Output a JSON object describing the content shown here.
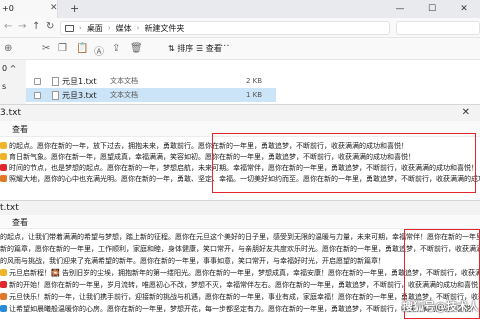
{
  "explorer": {
    "tab_title": "+0",
    "breadcrumb": [
      "桌面",
      "媒体",
      "新建文件夹"
    ],
    "toolbar": {
      "sort_label": "排序",
      "view_label": "查看",
      "more_label": "···"
    },
    "sidebar": [
      "0 ^",
      "s"
    ],
    "files": [
      {
        "name": "元旦1.txt",
        "type": "文本文档",
        "size": "2 KB",
        "selected": false
      },
      {
        "name": "元旦3.txt",
        "type": "文本文档",
        "size": "1 KB",
        "selected": true
      }
    ]
  },
  "notepad1": {
    "filename": "3.txt",
    "menu_view": "查看",
    "lines": [
      {
        "icon": "#f0b429",
        "text": "的起点。愿你在新的一年，放下过去，拥抱未来，勇敢前行。愿你在新的一年里，勇敢追梦，不断前行，收获满满的成功和喜悦！"
      },
      {
        "icon": "#f0b429",
        "text": "育日新气象。愿你在新一年，愿望成真，幸福满满，笑容如初。愿你在新的一年里，勇敢追梦，不断前行，收获满满的成功和喜悦！"
      },
      {
        "icon": "#e0272d",
        "text": "时间的节点，也是梦想的起点。愿你在新的一年，梦想启航，未来可期。幸福常伴，愿你在新的一年里，勇敢追梦，不断前行，收获满满的成功和喜悦！"
      },
      {
        "icon": "#e07a27",
        "text": "照耀大地，愿你的心中也充满光明。愿你在新的一年，勇敢、坚定、幸福。一切美好如约而至。愿你在新的一年里，勇敢追梦，不断前行，收获满满的成功和喜悦！"
      }
    ]
  },
  "notepad2": {
    "filename": "t.txt",
    "menu_view": "查看",
    "lines": [
      {
        "icon": null,
        "text": "的起点，让我们带着满满的希望与梦想，踏上新的征程。愿你在元旦这个美好的日子里，感受到无限的温暖与力量，未来可期，幸福常伴！愿你在新的一年里，勇"
      },
      {
        "icon": null,
        "text": "新的篇章，愿你在新的一年里，工作顺利，家庭和睦，身体健康，笑口常开，与亲朋好友共度欢乐时光。愿你在新的一年里，勇敢追梦，不断前行，收获满满的成功和喜悦！"
      },
      {
        "icon": null,
        "text": "的风雨与挑战，我们迎来了充满希望的新年。愿你在新的一年里，事事如意，笑口常开，与幸福好时光，开启愿望的新篇章！"
      },
      {
        "icon": "#f0b429",
        "text": "元旦启新程！🎇 告别旧岁的尘埃，拥抱新年的第一缕阳光。愿你在新的一年里，梦想成真，幸福安康！愿你在新的一年里，勇敢追梦，不断前行，收获满满的成功和喜悦！"
      },
      {
        "icon": "#e0272d",
        "text": "新的开始！愿你在新的一年里，岁月流转，唯愿初心不改，梦想不灭，幸福常伴左右。愿你在新的一年里，勇敢追梦，不断前行，收获满满的成功和喜悦！"
      },
      {
        "icon": "#e07a27",
        "text": "元旦快乐！新的一年，让我们携手前行，迎接新的挑战与机遇，愿你在新的一年里，事业有成，家庭幸福！愿你在新的一年里，勇敢追梦，不断前行，收获满满的成功和喜悦！"
      },
      {
        "icon": "#2a8bd6",
        "text": "让希望如晨曦般温暖你的心房。愿你在新的一年里，梦想开花，每一步都坚定有力。愿你在新的一年里，勇敢追梦，不断前行，收获满满的成功和喜悦！"
      }
    ]
  },
  "watermark": "搜狐号@技术人"
}
